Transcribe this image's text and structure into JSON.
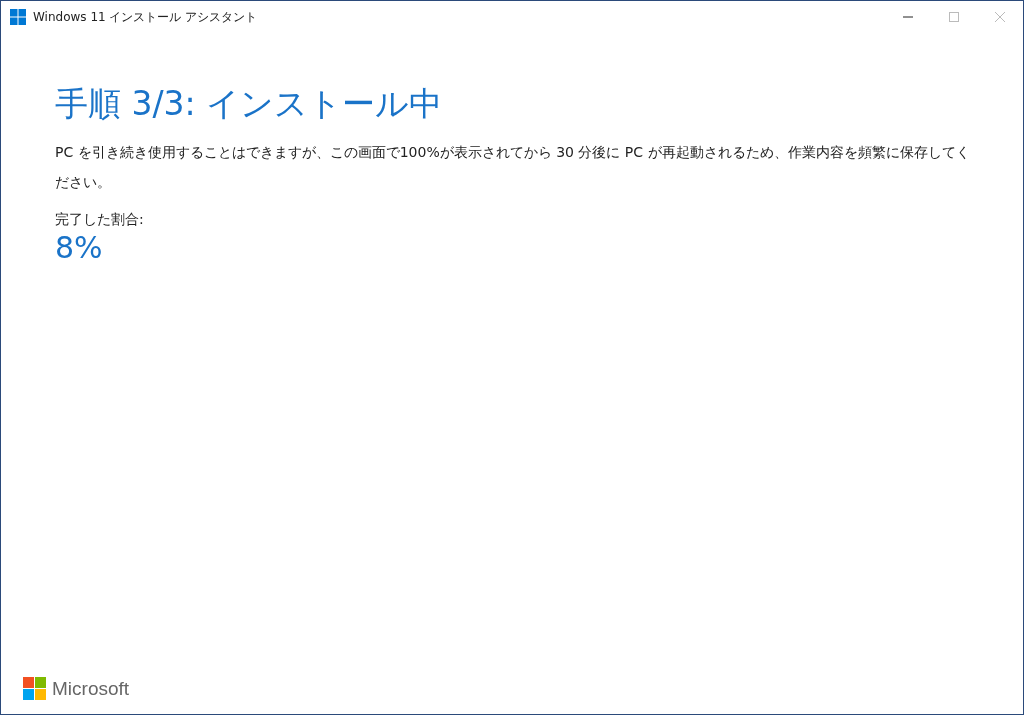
{
  "window": {
    "title": "Windows 11 インストール アシスタント"
  },
  "heading": "手順 3/3: インストール中",
  "description": "PC を引き続き使用することはできますが、この画面で100%が表示されてから 30 分後に PC が再起動されるため、作業内容を頻繁に保存してください。",
  "progress": {
    "label": "完了した割合:",
    "value": "8%"
  },
  "footer": {
    "brand": "Microsoft"
  }
}
